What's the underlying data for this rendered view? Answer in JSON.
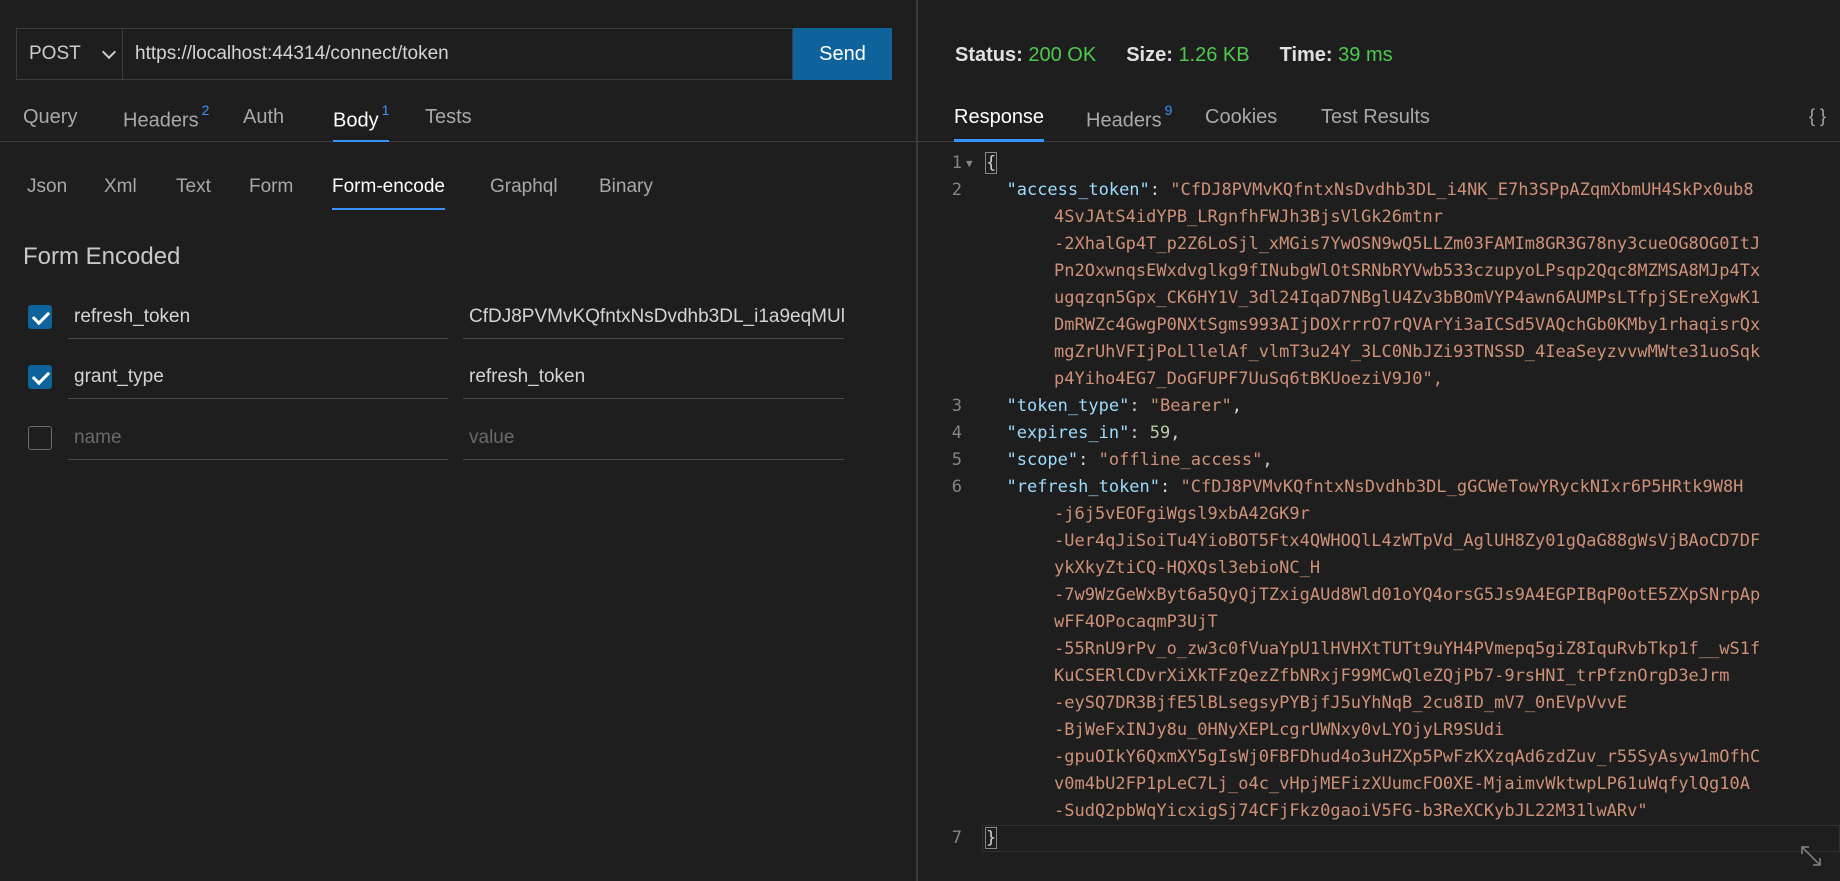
{
  "request": {
    "method": "POST",
    "url": "https://localhost:44314/connect/token",
    "send_label": "Send"
  },
  "main_tabs": [
    {
      "label": "Query",
      "badge": ""
    },
    {
      "label": "Headers",
      "badge": "2"
    },
    {
      "label": "Auth",
      "badge": ""
    },
    {
      "label": "Body",
      "badge": "1"
    },
    {
      "label": "Tests",
      "badge": ""
    }
  ],
  "body_tabs": [
    "Json",
    "Xml",
    "Text",
    "Form",
    "Form-encode",
    "Graphql",
    "Binary"
  ],
  "form": {
    "title": "Form Encoded",
    "rows": [
      {
        "checked": true,
        "name": "refresh_token",
        "value": "CfDJ8PVMvKQfntxNsDvdhb3DL_i1a9eqMUl("
      },
      {
        "checked": true,
        "name": "grant_type",
        "value": "refresh_token"
      }
    ],
    "empty_row": {
      "name_placeholder": "name",
      "value_placeholder": "value"
    }
  },
  "response": {
    "status_label": "Status:",
    "status_value": "200 OK",
    "size_label": "Size:",
    "size_value": "1.26 KB",
    "time_label": "Time:",
    "time_value": "39 ms",
    "tabs": [
      {
        "label": "Response",
        "badge": ""
      },
      {
        "label": "Headers",
        "badge": "9"
      },
      {
        "label": "Cookies",
        "badge": ""
      },
      {
        "label": "Test Results",
        "badge": ""
      }
    ],
    "braces_icon": "{ }"
  },
  "json_body": {
    "line_numbers": [
      "1",
      "2",
      "3",
      "4",
      "5",
      "6",
      "7"
    ],
    "open_brace": "{",
    "close_brace": "}",
    "access_token_key": "\"access_token\"",
    "access_token_lines": [
      "\"CfDJ8PVMvKQfntxNsDvdhb3DL_i4NK_E7h3SPpAZqmXbmUH4SkPx0ub8",
      "4SvJAtS4idYPB_LRgnfhFWJh3BjsVlGk26mtnr",
      "-2XhalGp4T_p2Z6LoSjl_xMGis7YwOSN9wQ5LLZm03FAMIm8GR3G78ny3cueOG8OG0ItJ",
      "Pn2OxwnqsEWxdvglkg9fINubgWlOtSRNbRYVwb533czupyoLPsqp2Qqc8MZMSA8MJp4Tx",
      "ugqzqn5Gpx_CK6HY1V_3dl24IqaD7NBglU4Zv3bBOmVYP4awn6AUMPsLTfpjSEreXgwK1",
      "DmRWZc4GwgP0NXtSgms993AIjDOXrrrO7rQVArYi3aICSd5VAQchGb0KMby1rhaqisrQx",
      "mgZrUhVFIjPoLllelAf_vlmT3u24Y_3LC0NbJZi93TNSSD_4IeaSeyzvvwMWte31uoSqk",
      "p4Yiho4EG7_DoGFUPF7UuSq6tBKUoeziV9J0\","
    ],
    "token_type_key": "\"token_type\"",
    "token_type_value": "\"Bearer\"",
    "expires_in_key": "\"expires_in\"",
    "expires_in_value": "59",
    "scope_key": "\"scope\"",
    "scope_value": "\"offline_access\"",
    "refresh_token_key": "\"refresh_token\"",
    "refresh_token_lines": [
      "\"CfDJ8PVMvKQfntxNsDvdhb3DL_gGCWeTowYRyckNIxr6P5HRtk9W8H",
      "-j6j5vEOFgiWgsl9xbA42GK9r",
      "-Uer4qJiSoiTu4YioBOT5Ftx4QWHOQlL4zWTpVd_AglUH8Zy01gQaG88gWsVjBAoCD7DF",
      "ykXkyZtiCQ-HQXQsl3ebioNC_H",
      "-7w9WzGeWxByt6a5QyQjTZxigAUd8Wld01oYQ4orsG5Js9A4EGPIBqP0otE5ZXpSNrpAp",
      "wFF4OPocaqmP3UjT",
      "-55RnU9rPv_o_zw3c0fVuaYpU1lHVHXtTUTt9uYH4PVmepq5giZ8IquRvbTkp1f__wS1f",
      "KuCSERlCDvrXiXkTFzQezZfbNRxjF99MCwQleZQjPb7-9rsHNI_trPfznOrgD3eJrm",
      "-eySQ7DR3BjfE5lBLsegsyPYBjfJ5uYhNqB_2cu8ID_mV7_0nEVpVvvE",
      "-BjWeFxINJy8u_0HNyXEPLcgrUWNxy0vLYOjyLR9SUdi",
      "-gpuOIkY6QxmXY5gIsWj0FBFDhud4o3uHZXp5PwFzKXzqAd6zdZuv_r55SyAsyw1mOfhC",
      "v0m4bU2FP1pLeC7Lj_o4c_vHpjMEFizXUumcFO0XE-MjaimvWktwpLP61uWqfylQg10A",
      "-SudQ2pbWqYicxigSj74CFjFkz0gaoiV5FG-b3ReXCKybJL22M31lwARv\""
    ]
  }
}
